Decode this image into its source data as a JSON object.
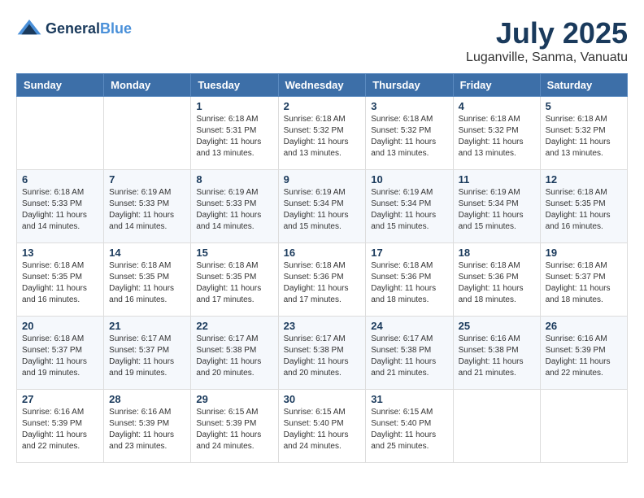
{
  "header": {
    "logo_line1": "General",
    "logo_line2": "Blue",
    "month_year": "July 2025",
    "location": "Luganville, Sanma, Vanuatu"
  },
  "columns": [
    "Sunday",
    "Monday",
    "Tuesday",
    "Wednesday",
    "Thursday",
    "Friday",
    "Saturday"
  ],
  "weeks": [
    [
      {
        "day": "",
        "info": ""
      },
      {
        "day": "",
        "info": ""
      },
      {
        "day": "1",
        "info": "Sunrise: 6:18 AM\nSunset: 5:31 PM\nDaylight: 11 hours and 13 minutes."
      },
      {
        "day": "2",
        "info": "Sunrise: 6:18 AM\nSunset: 5:32 PM\nDaylight: 11 hours and 13 minutes."
      },
      {
        "day": "3",
        "info": "Sunrise: 6:18 AM\nSunset: 5:32 PM\nDaylight: 11 hours and 13 minutes."
      },
      {
        "day": "4",
        "info": "Sunrise: 6:18 AM\nSunset: 5:32 PM\nDaylight: 11 hours and 13 minutes."
      },
      {
        "day": "5",
        "info": "Sunrise: 6:18 AM\nSunset: 5:32 PM\nDaylight: 11 hours and 13 minutes."
      }
    ],
    [
      {
        "day": "6",
        "info": "Sunrise: 6:18 AM\nSunset: 5:33 PM\nDaylight: 11 hours and 14 minutes."
      },
      {
        "day": "7",
        "info": "Sunrise: 6:19 AM\nSunset: 5:33 PM\nDaylight: 11 hours and 14 minutes."
      },
      {
        "day": "8",
        "info": "Sunrise: 6:19 AM\nSunset: 5:33 PM\nDaylight: 11 hours and 14 minutes."
      },
      {
        "day": "9",
        "info": "Sunrise: 6:19 AM\nSunset: 5:34 PM\nDaylight: 11 hours and 15 minutes."
      },
      {
        "day": "10",
        "info": "Sunrise: 6:19 AM\nSunset: 5:34 PM\nDaylight: 11 hours and 15 minutes."
      },
      {
        "day": "11",
        "info": "Sunrise: 6:19 AM\nSunset: 5:34 PM\nDaylight: 11 hours and 15 minutes."
      },
      {
        "day": "12",
        "info": "Sunrise: 6:18 AM\nSunset: 5:35 PM\nDaylight: 11 hours and 16 minutes."
      }
    ],
    [
      {
        "day": "13",
        "info": "Sunrise: 6:18 AM\nSunset: 5:35 PM\nDaylight: 11 hours and 16 minutes."
      },
      {
        "day": "14",
        "info": "Sunrise: 6:18 AM\nSunset: 5:35 PM\nDaylight: 11 hours and 16 minutes."
      },
      {
        "day": "15",
        "info": "Sunrise: 6:18 AM\nSunset: 5:35 PM\nDaylight: 11 hours and 17 minutes."
      },
      {
        "day": "16",
        "info": "Sunrise: 6:18 AM\nSunset: 5:36 PM\nDaylight: 11 hours and 17 minutes."
      },
      {
        "day": "17",
        "info": "Sunrise: 6:18 AM\nSunset: 5:36 PM\nDaylight: 11 hours and 18 minutes."
      },
      {
        "day": "18",
        "info": "Sunrise: 6:18 AM\nSunset: 5:36 PM\nDaylight: 11 hours and 18 minutes."
      },
      {
        "day": "19",
        "info": "Sunrise: 6:18 AM\nSunset: 5:37 PM\nDaylight: 11 hours and 18 minutes."
      }
    ],
    [
      {
        "day": "20",
        "info": "Sunrise: 6:18 AM\nSunset: 5:37 PM\nDaylight: 11 hours and 19 minutes."
      },
      {
        "day": "21",
        "info": "Sunrise: 6:17 AM\nSunset: 5:37 PM\nDaylight: 11 hours and 19 minutes."
      },
      {
        "day": "22",
        "info": "Sunrise: 6:17 AM\nSunset: 5:38 PM\nDaylight: 11 hours and 20 minutes."
      },
      {
        "day": "23",
        "info": "Sunrise: 6:17 AM\nSunset: 5:38 PM\nDaylight: 11 hours and 20 minutes."
      },
      {
        "day": "24",
        "info": "Sunrise: 6:17 AM\nSunset: 5:38 PM\nDaylight: 11 hours and 21 minutes."
      },
      {
        "day": "25",
        "info": "Sunrise: 6:16 AM\nSunset: 5:38 PM\nDaylight: 11 hours and 21 minutes."
      },
      {
        "day": "26",
        "info": "Sunrise: 6:16 AM\nSunset: 5:39 PM\nDaylight: 11 hours and 22 minutes."
      }
    ],
    [
      {
        "day": "27",
        "info": "Sunrise: 6:16 AM\nSunset: 5:39 PM\nDaylight: 11 hours and 22 minutes."
      },
      {
        "day": "28",
        "info": "Sunrise: 6:16 AM\nSunset: 5:39 PM\nDaylight: 11 hours and 23 minutes."
      },
      {
        "day": "29",
        "info": "Sunrise: 6:15 AM\nSunset: 5:39 PM\nDaylight: 11 hours and 24 minutes."
      },
      {
        "day": "30",
        "info": "Sunrise: 6:15 AM\nSunset: 5:40 PM\nDaylight: 11 hours and 24 minutes."
      },
      {
        "day": "31",
        "info": "Sunrise: 6:15 AM\nSunset: 5:40 PM\nDaylight: 11 hours and 25 minutes."
      },
      {
        "day": "",
        "info": ""
      },
      {
        "day": "",
        "info": ""
      }
    ]
  ]
}
